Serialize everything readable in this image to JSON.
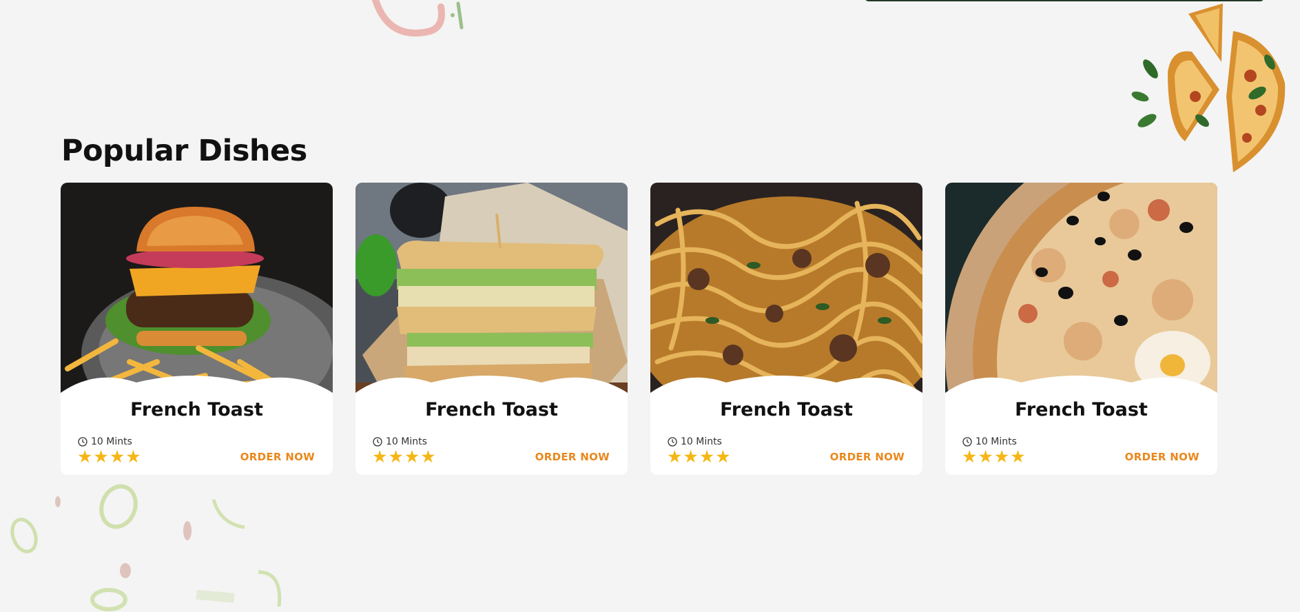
{
  "section": {
    "title": "Popular Dishes"
  },
  "cards": [
    {
      "name": "French Toast",
      "time": "10 Mints",
      "rating": 4,
      "order_label": "ORDER NOW",
      "image": "burger-with-fries-image"
    },
    {
      "name": "French Toast",
      "time": "10 Mints",
      "rating": 4,
      "order_label": "ORDER NOW",
      "image": "sandwich-image"
    },
    {
      "name": "French Toast",
      "time": "10 Mints",
      "rating": 4,
      "order_label": "ORDER NOW",
      "image": "pasta-image"
    },
    {
      "name": "French Toast",
      "time": "10 Mints",
      "rating": 4,
      "order_label": "ORDER NOW",
      "image": "pizza-image"
    }
  ],
  "colors": {
    "accent": "#e9881c",
    "star": "#f6b614",
    "background": "#f4f4f4"
  },
  "icons": {
    "time": "clock-icon",
    "rating": "star-icon"
  }
}
